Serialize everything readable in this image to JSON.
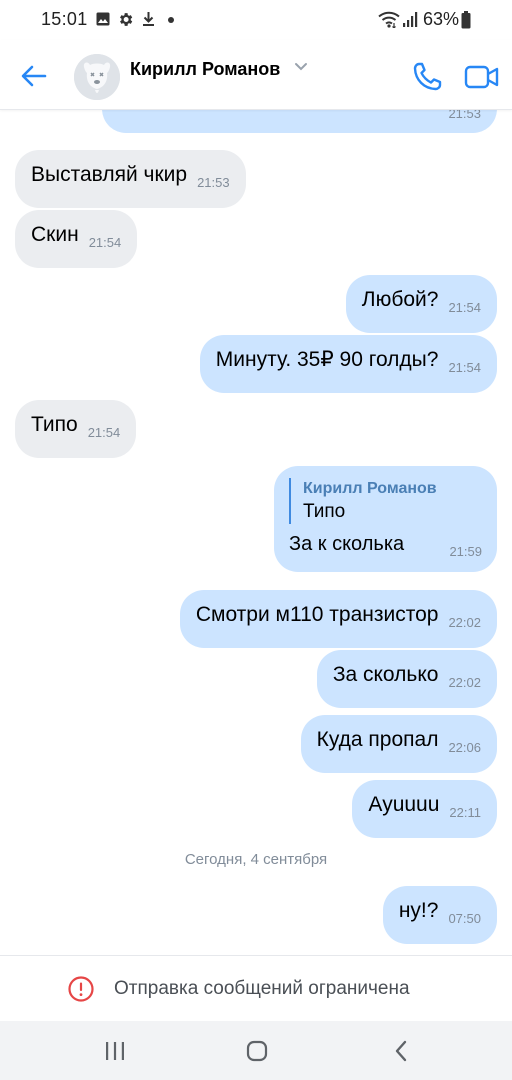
{
  "status_bar": {
    "time": "15:01",
    "battery": "63%",
    "icons": [
      "image-icon",
      "gear-icon",
      "download-icon",
      "dot-icon",
      "wifi-icon",
      "signal-icon",
      "battery-icon"
    ]
  },
  "header": {
    "contact_name": "Кирилл Романов",
    "icons": [
      "back-arrow-icon",
      "chevron-down-icon",
      "phone-icon",
      "video-camera-icon"
    ]
  },
  "messages": [
    {
      "dir": "out",
      "text": "",
      "time": "21:53"
    },
    {
      "dir": "in",
      "text": "Выставляй чкир",
      "time": "21:53"
    },
    {
      "dir": "in",
      "text": "Скин",
      "time": "21:54"
    },
    {
      "dir": "out",
      "text": "Любой?",
      "time": "21:54"
    },
    {
      "dir": "out",
      "text": "Минуту. 35₽ 90 голды?",
      "time": "21:54"
    },
    {
      "dir": "in",
      "text": "Типо",
      "time": "21:54"
    },
    {
      "dir": "out",
      "reply_author": "Кирилл Романов",
      "reply_text": "Типо",
      "text": "За  к сколька",
      "time": "21:59"
    },
    {
      "dir": "out",
      "text": "Смотри м110 транзистор",
      "time": "22:02"
    },
    {
      "dir": "out",
      "text": "За сколько",
      "time": "22:02"
    },
    {
      "dir": "out",
      "text": "Куда пропал",
      "time": "22:06"
    },
    {
      "dir": "out",
      "text": "Ауuuuu",
      "time": "22:11"
    },
    {
      "dir": "out",
      "text": "ну!?",
      "time": "07:50"
    }
  ],
  "date_separator": "Сегодня, 4 сентября",
  "restriction": {
    "text": "Отправка сообщений ограничена",
    "icon": "warning-circle-icon",
    "color": "#e64646"
  },
  "colors": {
    "accent": "#2787f5",
    "outgoing_bubble": "#cce4ff",
    "incoming_bubble": "#ebedf0",
    "time_text": "#818c99"
  },
  "navbar": {
    "icons": [
      "recent-apps-icon",
      "home-icon",
      "back-icon"
    ]
  }
}
